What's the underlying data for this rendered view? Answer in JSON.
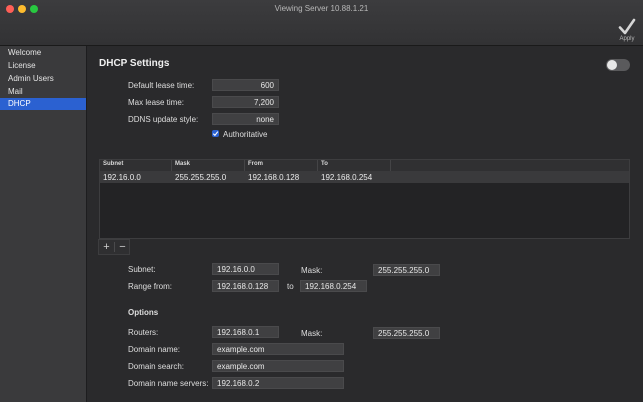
{
  "window": {
    "title": "Viewing Server 10.88.1.21"
  },
  "toolbar": {
    "apply_label": "Apply"
  },
  "sidebar": {
    "items": [
      {
        "label": "Welcome",
        "active": false
      },
      {
        "label": "License",
        "active": false
      },
      {
        "label": "Admin Users",
        "active": false
      },
      {
        "label": "Mail",
        "active": false
      },
      {
        "label": "DHCP",
        "active": true
      }
    ]
  },
  "dhcp": {
    "title": "DHCP Settings",
    "enabled": false,
    "default_lease": {
      "label": "Default lease time:",
      "value": "600"
    },
    "max_lease": {
      "label": "Max lease time:",
      "value": "7,200"
    },
    "ddns": {
      "label": "DDNS update style:",
      "value": "none"
    },
    "authoritative": {
      "label": "Authoritative",
      "checked": true
    }
  },
  "table": {
    "columns": [
      "Subnet",
      "Mask",
      "From",
      "To"
    ],
    "rows": [
      {
        "subnet": "192.16.0.0",
        "mask": "255.255.255.0",
        "from": "192.168.0.128",
        "to": "192.168.0.254"
      }
    ]
  },
  "buttons": {
    "add": "+",
    "remove": "−"
  },
  "detail": {
    "subnet_label": "Subnet:",
    "subnet_value": "192.16.0.0",
    "mask_label": "Mask:",
    "mask_value": "255.255.255.0",
    "range_label": "Range from:",
    "range_from": "192.168.0.128",
    "range_to_label": "to",
    "range_to": "192.168.0.254"
  },
  "options": {
    "heading": "Options",
    "routers_label": "Routers:",
    "routers_value": "192.168.0.1",
    "mask_label": "Mask:",
    "mask_value": "255.255.255.0",
    "domain_name_label": "Domain name:",
    "domain_name_value": "example.com",
    "domain_search_label": "Domain search:",
    "domain_search_value": "example.com",
    "dns_label": "Domain name servers:",
    "dns_value": "192.168.0.2"
  },
  "colors": {
    "accent": "#2b61d1",
    "close": "#ff5f57",
    "minimize": "#febc2e",
    "zoom": "#28c840"
  },
  "icons": {
    "apply": "checkmark-icon",
    "checkbox": "checkbox-checked-icon"
  }
}
